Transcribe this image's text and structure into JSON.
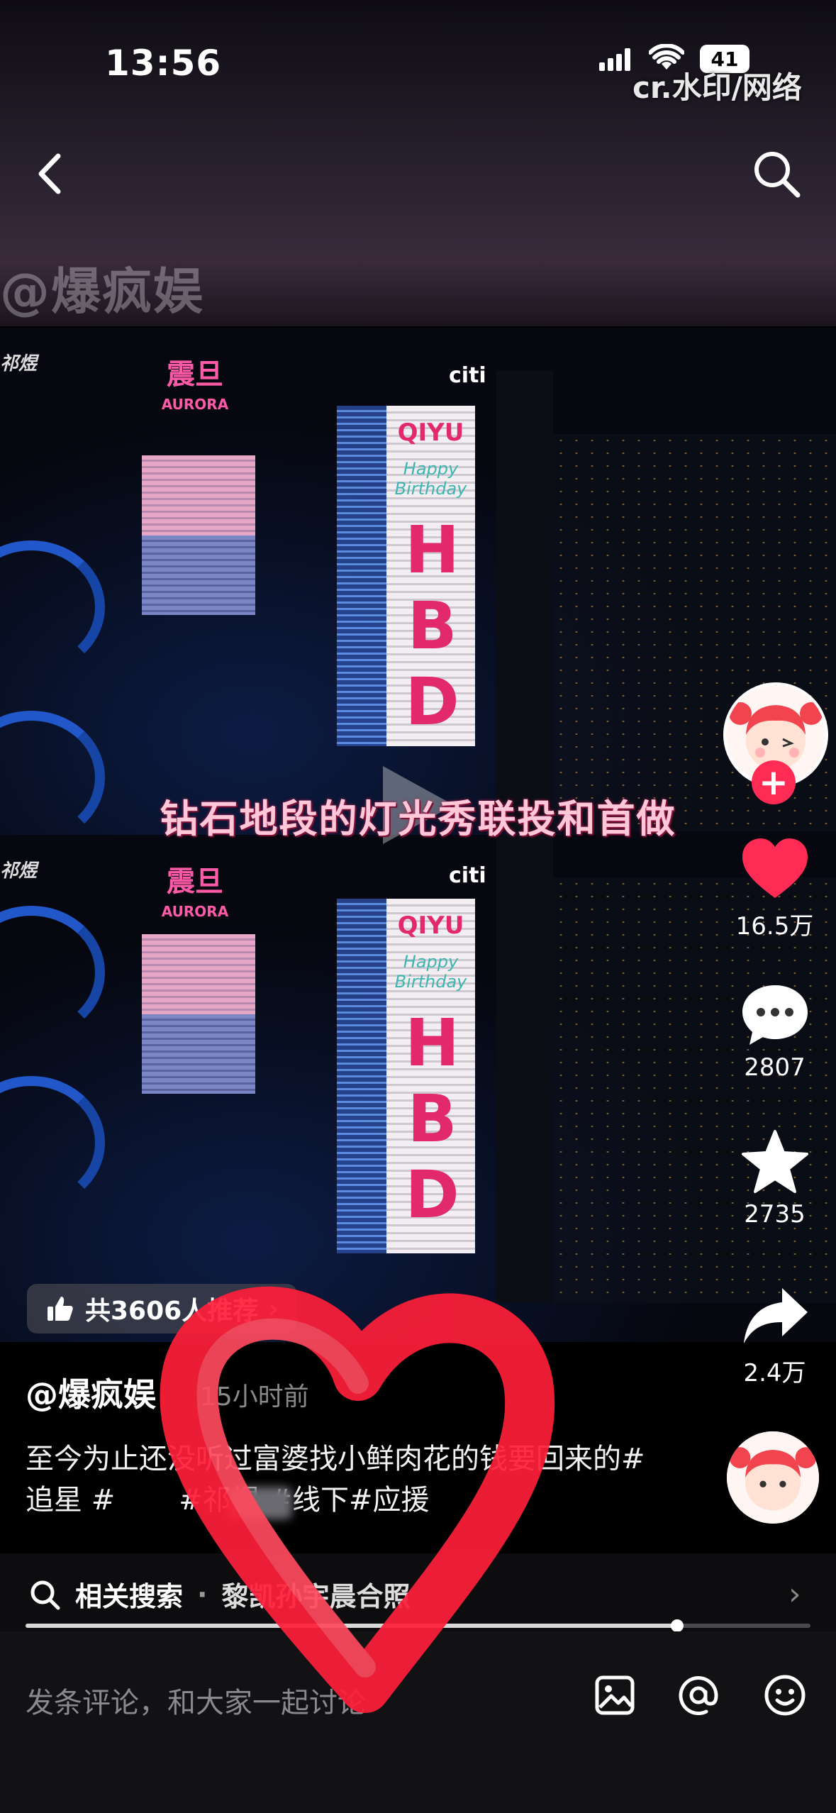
{
  "status_bar": {
    "time": "13:56",
    "battery": "41",
    "watermark": "cr.水印/网络"
  },
  "header": {
    "overlay_author": "@爆疯娱"
  },
  "video": {
    "caption_overlay": "钻石地段的灯光秀联投和首做",
    "billboard_top": "QIYU",
    "billboard_sub": "Happy Birthday",
    "billboard_main": "HBD",
    "aurora_cn": "震旦",
    "aurora_en": "AURORA",
    "citi": "citi"
  },
  "recommend": {
    "label": "共3606人推荐",
    "chevron": "›"
  },
  "right_rail": {
    "likes": "16.5万",
    "comments": "2807",
    "favorites": "2735",
    "shares": "2.4万",
    "follow_plus": "+"
  },
  "post": {
    "author": "@爆疯娱",
    "time": "15小时前",
    "description": "至今为止还没听过富婆找小鲜肉花的钱要回来的#追星 #",
    "description_tail": "#祁煜 #线下#应援"
  },
  "related_search": {
    "label": "相关搜索",
    "query": "黎凯孙宇晨合照",
    "progress": 0.83
  },
  "comment_bar": {
    "placeholder": "发条评论，和大家一起讨论"
  },
  "icons": {
    "back": "back-icon",
    "search": "search-icon",
    "like": "heart-icon",
    "comment": "comment-icon",
    "favorite": "star-icon",
    "share": "share-icon",
    "image": "image-icon",
    "mention": "at-icon",
    "emoji": "emoji-icon"
  },
  "colors": {
    "like_red": "#fe2c55",
    "heart_scribble": "#ff1f3a"
  }
}
